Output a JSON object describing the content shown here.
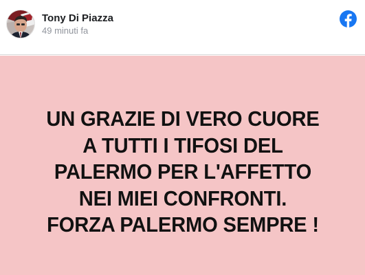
{
  "post": {
    "author": {
      "name": "Tony Di Piazza",
      "avatar_icon": "profile-photo-avatar"
    },
    "timestamp": "49 minuti fa",
    "platform_icon": "facebook-logo-icon",
    "background_color": "#f5c5c6",
    "message_lines": [
      "UN GRAZIE DI VERO CUORE",
      "A TUTTI I TIFOSI DEL",
      "PALERMO PER L'AFFETTO",
      "NEI MIEI CONFRONTI.",
      "FORZA PALERMO SEMPRE !"
    ]
  },
  "colors": {
    "facebook_blue": "#1877f2",
    "name_text": "#1c1e21",
    "time_text": "#90949c",
    "message_text": "#111111"
  }
}
